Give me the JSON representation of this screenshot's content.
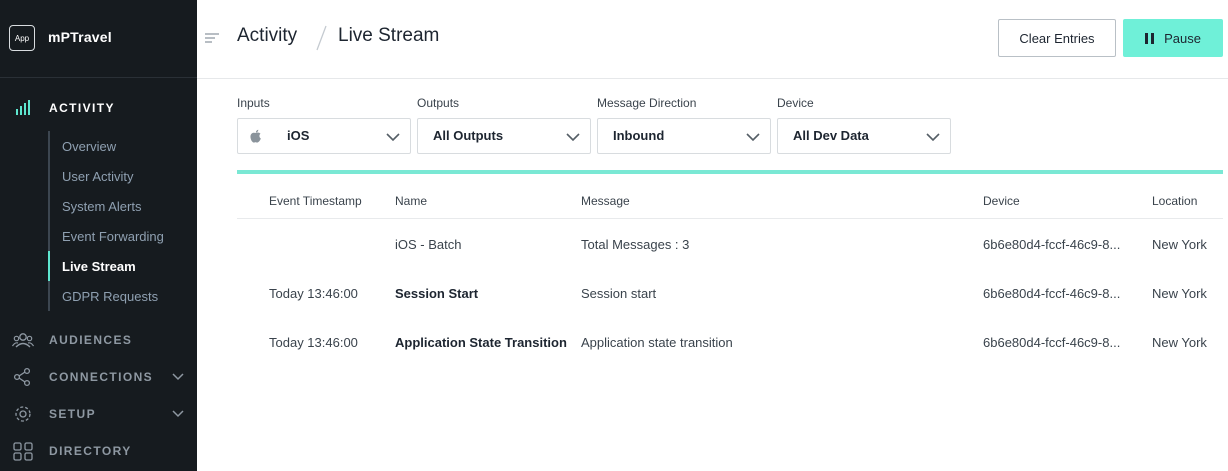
{
  "brand": {
    "badge": "App",
    "name": "mPTravel"
  },
  "sidebar": {
    "sections": [
      {
        "label": "ACTIVITY",
        "icon": "bar-chart-icon",
        "active": true
      },
      {
        "label": "AUDIENCES",
        "icon": "people-icon"
      },
      {
        "label": "CONNECTIONS",
        "icon": "connections-icon"
      },
      {
        "label": "SETUP",
        "icon": "gear-icon"
      },
      {
        "label": "DIRECTORY",
        "icon": "grid-icon"
      }
    ],
    "subitems": [
      {
        "label": "Overview"
      },
      {
        "label": "User Activity"
      },
      {
        "label": "System Alerts"
      },
      {
        "label": "Event Forwarding"
      },
      {
        "label": "Live Stream",
        "active": true
      },
      {
        "label": "GDPR Requests"
      }
    ]
  },
  "header": {
    "breadcrumb": [
      "Activity",
      "Live Stream"
    ],
    "clear_label": "Clear Entries",
    "pause_label": "Pause"
  },
  "filters": [
    {
      "label": "Inputs",
      "value": "iOS",
      "icon": "apple-icon"
    },
    {
      "label": "Outputs",
      "value": "All Outputs"
    },
    {
      "label": "Message Direction",
      "value": "Inbound"
    },
    {
      "label": "Device",
      "value": "All Dev Data"
    }
  ],
  "table": {
    "columns": [
      "Event Timestamp",
      "Name",
      "Message",
      "Device",
      "Location"
    ],
    "rows": [
      {
        "timestamp": "",
        "name": "iOS - Batch",
        "message": "Total Messages : 3",
        "device": "6b6e80d4-fccf-46c9-8...",
        "location": "New York",
        "bold": false
      },
      {
        "timestamp": "Today 13:46:00",
        "name": "Session Start",
        "message": "Session start",
        "device": "6b6e80d4-fccf-46c9-8...",
        "location": "New York",
        "bold": true
      },
      {
        "timestamp": "Today 13:46:00",
        "name": "Application State Transition",
        "message": "Application state transition",
        "device": "6b6e80d4-fccf-46c9-8...",
        "location": "New York",
        "bold": true
      }
    ]
  },
  "colors": {
    "accent": "#6ff0d8",
    "sidebar_bg": "#161b1f",
    "active_nav": "#5ee6cf"
  }
}
